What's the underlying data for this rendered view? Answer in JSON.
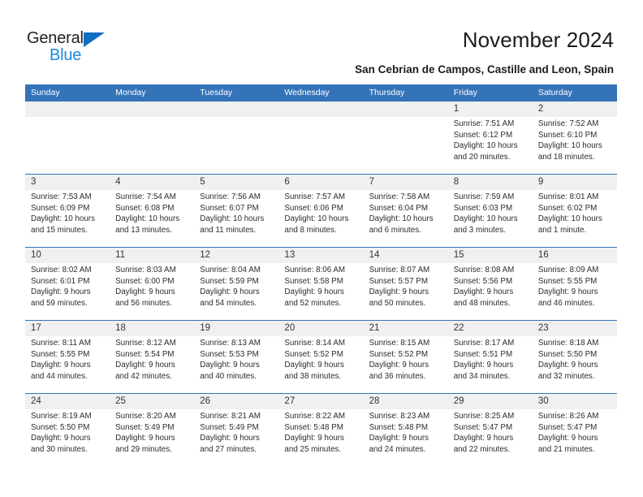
{
  "brand": {
    "name_part1": "General",
    "name_part2": "Blue",
    "triangle_color": "#0f6fc0",
    "blue_text_color": "#1b8ade"
  },
  "header": {
    "title": "November 2024",
    "subtitle": "San Cebrian de Campos, Castille and Leon, Spain"
  },
  "theme": {
    "header_blue": "#3573b9",
    "datestrip_gray": "#f0f0f0",
    "text_color": "#2c2c2c"
  },
  "weekdays": [
    "Sunday",
    "Monday",
    "Tuesday",
    "Wednesday",
    "Thursday",
    "Friday",
    "Saturday"
  ],
  "weeks": [
    [
      {
        "day": "",
        "lines": []
      },
      {
        "day": "",
        "lines": []
      },
      {
        "day": "",
        "lines": []
      },
      {
        "day": "",
        "lines": []
      },
      {
        "day": "",
        "lines": []
      },
      {
        "day": "1",
        "lines": [
          "Sunrise: 7:51 AM",
          "Sunset: 6:12 PM",
          "Daylight: 10 hours",
          "and 20 minutes."
        ]
      },
      {
        "day": "2",
        "lines": [
          "Sunrise: 7:52 AM",
          "Sunset: 6:10 PM",
          "Daylight: 10 hours",
          "and 18 minutes."
        ]
      }
    ],
    [
      {
        "day": "3",
        "lines": [
          "Sunrise: 7:53 AM",
          "Sunset: 6:09 PM",
          "Daylight: 10 hours",
          "and 15 minutes."
        ]
      },
      {
        "day": "4",
        "lines": [
          "Sunrise: 7:54 AM",
          "Sunset: 6:08 PM",
          "Daylight: 10 hours",
          "and 13 minutes."
        ]
      },
      {
        "day": "5",
        "lines": [
          "Sunrise: 7:56 AM",
          "Sunset: 6:07 PM",
          "Daylight: 10 hours",
          "and 11 minutes."
        ]
      },
      {
        "day": "6",
        "lines": [
          "Sunrise: 7:57 AM",
          "Sunset: 6:06 PM",
          "Daylight: 10 hours",
          "and 8 minutes."
        ]
      },
      {
        "day": "7",
        "lines": [
          "Sunrise: 7:58 AM",
          "Sunset: 6:04 PM",
          "Daylight: 10 hours",
          "and 6 minutes."
        ]
      },
      {
        "day": "8",
        "lines": [
          "Sunrise: 7:59 AM",
          "Sunset: 6:03 PM",
          "Daylight: 10 hours",
          "and 3 minutes."
        ]
      },
      {
        "day": "9",
        "lines": [
          "Sunrise: 8:01 AM",
          "Sunset: 6:02 PM",
          "Daylight: 10 hours",
          "and 1 minute."
        ]
      }
    ],
    [
      {
        "day": "10",
        "lines": [
          "Sunrise: 8:02 AM",
          "Sunset: 6:01 PM",
          "Daylight: 9 hours",
          "and 59 minutes."
        ]
      },
      {
        "day": "11",
        "lines": [
          "Sunrise: 8:03 AM",
          "Sunset: 6:00 PM",
          "Daylight: 9 hours",
          "and 56 minutes."
        ]
      },
      {
        "day": "12",
        "lines": [
          "Sunrise: 8:04 AM",
          "Sunset: 5:59 PM",
          "Daylight: 9 hours",
          "and 54 minutes."
        ]
      },
      {
        "day": "13",
        "lines": [
          "Sunrise: 8:06 AM",
          "Sunset: 5:58 PM",
          "Daylight: 9 hours",
          "and 52 minutes."
        ]
      },
      {
        "day": "14",
        "lines": [
          "Sunrise: 8:07 AM",
          "Sunset: 5:57 PM",
          "Daylight: 9 hours",
          "and 50 minutes."
        ]
      },
      {
        "day": "15",
        "lines": [
          "Sunrise: 8:08 AM",
          "Sunset: 5:56 PM",
          "Daylight: 9 hours",
          "and 48 minutes."
        ]
      },
      {
        "day": "16",
        "lines": [
          "Sunrise: 8:09 AM",
          "Sunset: 5:55 PM",
          "Daylight: 9 hours",
          "and 46 minutes."
        ]
      }
    ],
    [
      {
        "day": "17",
        "lines": [
          "Sunrise: 8:11 AM",
          "Sunset: 5:55 PM",
          "Daylight: 9 hours",
          "and 44 minutes."
        ]
      },
      {
        "day": "18",
        "lines": [
          "Sunrise: 8:12 AM",
          "Sunset: 5:54 PM",
          "Daylight: 9 hours",
          "and 42 minutes."
        ]
      },
      {
        "day": "19",
        "lines": [
          "Sunrise: 8:13 AM",
          "Sunset: 5:53 PM",
          "Daylight: 9 hours",
          "and 40 minutes."
        ]
      },
      {
        "day": "20",
        "lines": [
          "Sunrise: 8:14 AM",
          "Sunset: 5:52 PM",
          "Daylight: 9 hours",
          "and 38 minutes."
        ]
      },
      {
        "day": "21",
        "lines": [
          "Sunrise: 8:15 AM",
          "Sunset: 5:52 PM",
          "Daylight: 9 hours",
          "and 36 minutes."
        ]
      },
      {
        "day": "22",
        "lines": [
          "Sunrise: 8:17 AM",
          "Sunset: 5:51 PM",
          "Daylight: 9 hours",
          "and 34 minutes."
        ]
      },
      {
        "day": "23",
        "lines": [
          "Sunrise: 8:18 AM",
          "Sunset: 5:50 PM",
          "Daylight: 9 hours",
          "and 32 minutes."
        ]
      }
    ],
    [
      {
        "day": "24",
        "lines": [
          "Sunrise: 8:19 AM",
          "Sunset: 5:50 PM",
          "Daylight: 9 hours",
          "and 30 minutes."
        ]
      },
      {
        "day": "25",
        "lines": [
          "Sunrise: 8:20 AM",
          "Sunset: 5:49 PM",
          "Daylight: 9 hours",
          "and 29 minutes."
        ]
      },
      {
        "day": "26",
        "lines": [
          "Sunrise: 8:21 AM",
          "Sunset: 5:49 PM",
          "Daylight: 9 hours",
          "and 27 minutes."
        ]
      },
      {
        "day": "27",
        "lines": [
          "Sunrise: 8:22 AM",
          "Sunset: 5:48 PM",
          "Daylight: 9 hours",
          "and 25 minutes."
        ]
      },
      {
        "day": "28",
        "lines": [
          "Sunrise: 8:23 AM",
          "Sunset: 5:48 PM",
          "Daylight: 9 hours",
          "and 24 minutes."
        ]
      },
      {
        "day": "29",
        "lines": [
          "Sunrise: 8:25 AM",
          "Sunset: 5:47 PM",
          "Daylight: 9 hours",
          "and 22 minutes."
        ]
      },
      {
        "day": "30",
        "lines": [
          "Sunrise: 8:26 AM",
          "Sunset: 5:47 PM",
          "Daylight: 9 hours",
          "and 21 minutes."
        ]
      }
    ]
  ]
}
